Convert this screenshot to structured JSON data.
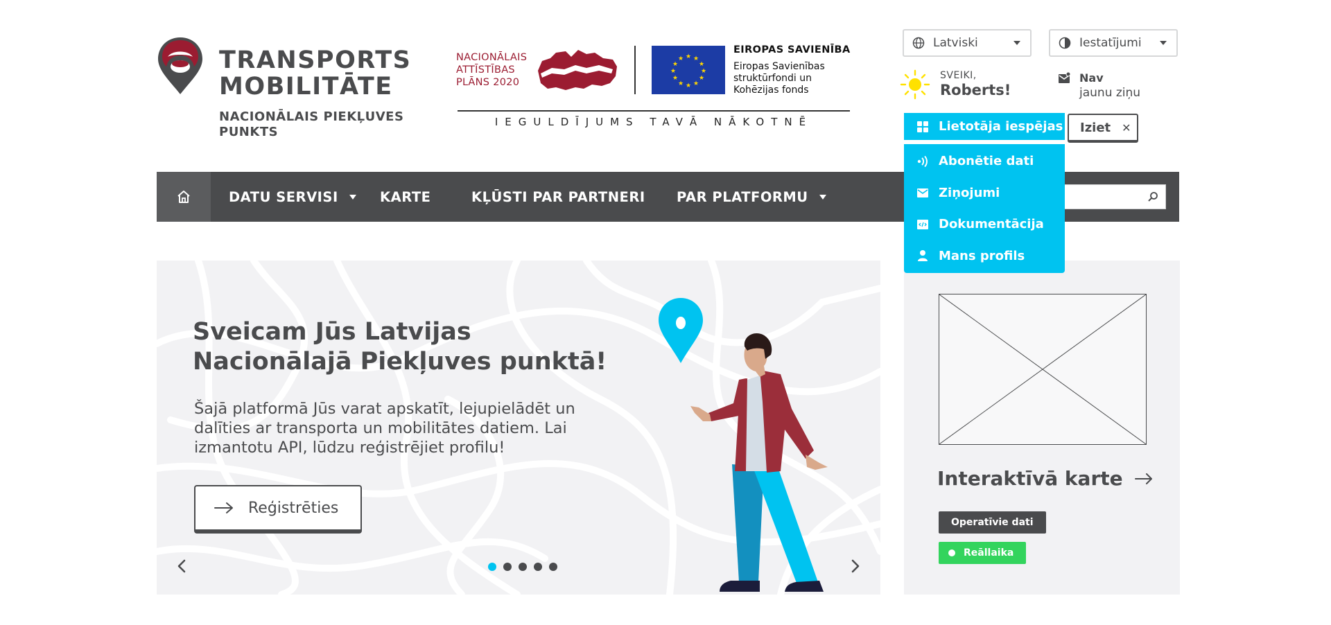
{
  "logo": {
    "title_line1": "TRANSPORTS",
    "title_line2": "MOBILITĀTE",
    "subtitle_line1": "NACIONĀLAIS PIEKĻUVES",
    "subtitle_line2": "PUNKTS",
    "brand_color": "#9b1c31"
  },
  "funding": {
    "nap_line1": "NACIONĀLAIS",
    "nap_line2": "ATTĪSTĪBAS",
    "nap_line3": "PLĀNS 2020",
    "eu_title": "EIROPAS SAVIENĪBA",
    "eu_line1": "Eiropas Savienības",
    "eu_line2": "struktūrfondi un",
    "eu_line3": "Kohēzijas fonds",
    "motto": "IEGULDĪJUMS TAVĀ NĀKOTNĒ"
  },
  "header": {
    "language": "Latviski",
    "settings": "Iestatījumi",
    "greeting_small": "SVEIKI,",
    "greeting_name": "Roberts!",
    "messages_bold": "Nav",
    "messages_light": "jaunu ziņu",
    "logout": "Iziet"
  },
  "user_menu": {
    "button_label": "Lietotāja iespējas",
    "items": [
      {
        "label": "Abonētie dati",
        "icon": "signal-icon"
      },
      {
        "label": "Ziņojumi",
        "icon": "mail-icon"
      },
      {
        "label": "Dokumentācija",
        "icon": "code-icon"
      },
      {
        "label": "Mans profils",
        "icon": "user-icon"
      }
    ],
    "accent_color": "#00c3f0"
  },
  "nav": {
    "items": [
      {
        "label": "DATU SERVISI",
        "has_dropdown": true
      },
      {
        "label": "KARTE",
        "has_dropdown": false
      },
      {
        "label": "KĻŪSTI PAR PARTNERI",
        "has_dropdown": false
      },
      {
        "label": "PAR PLATFORMU",
        "has_dropdown": true
      }
    ],
    "search_placeholder": ""
  },
  "hero": {
    "title": "Sveicam Jūs Latvijas Nacionālajā Piekļuves punktā!",
    "text": "Šajā platformā Jūs varat apskatīt, lejupielādēt un dalīties ar transporta un mobilitātes datiem. Lai izmantotu API, lūdzu reģistrējiet profilu!",
    "register_button": "Reģistrēties",
    "slide_count": 5,
    "active_slide": 1
  },
  "side_card": {
    "title": "Interaktīvā karte",
    "tag_dark": "Operatīvie dati",
    "tag_green": "Reāllaika",
    "green_color": "#33d45d"
  }
}
